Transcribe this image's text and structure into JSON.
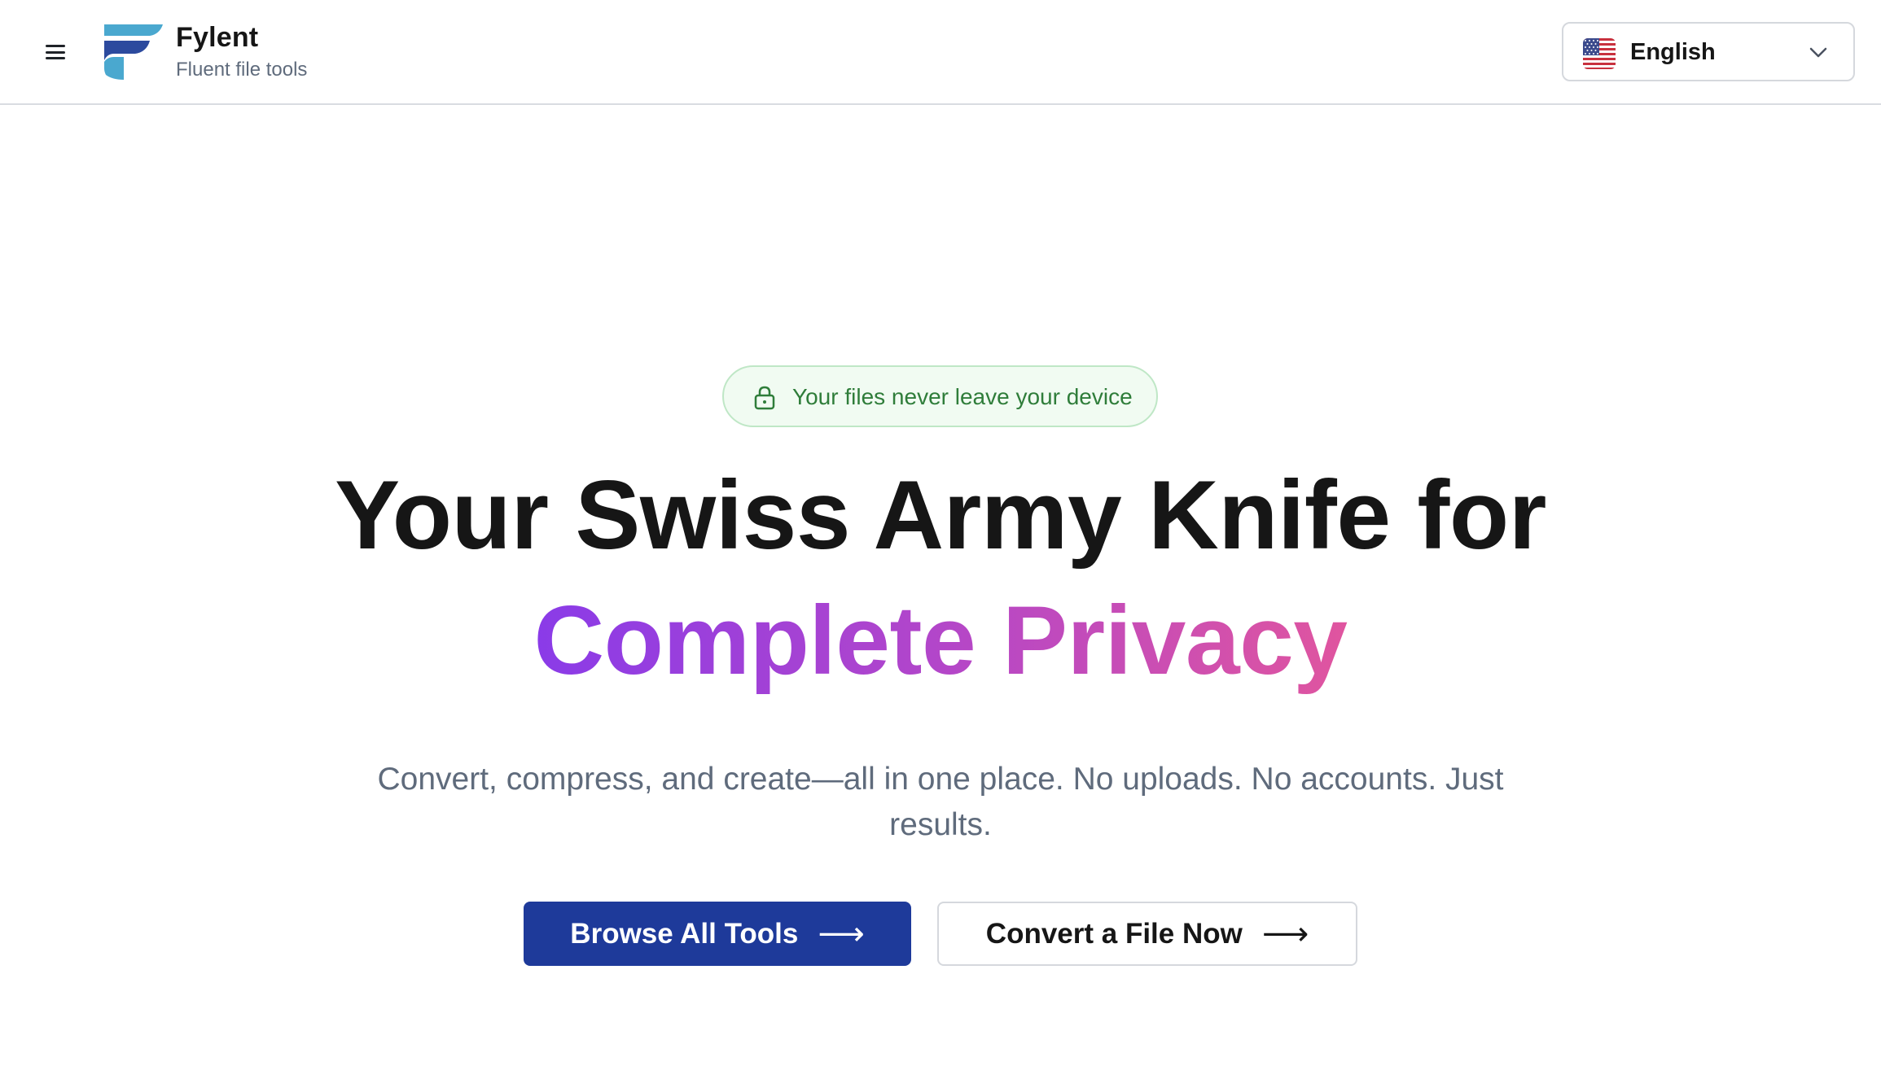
{
  "header": {
    "brand_name": "Fylent",
    "brand_tagline": "Fluent file tools",
    "language": {
      "selected": "English",
      "flag_icon": "us-flag-icon"
    }
  },
  "hero": {
    "badge_text": "Your files never leave your device",
    "headline_line1": "Your Swiss Army Knife for",
    "headline_line2": "Complete Privacy",
    "subtitle": "Convert, compress, and create—all in one place. No uploads. No accounts. Just results.",
    "primary_button": "Browse All Tools",
    "secondary_button": "Convert a File Now",
    "arrow_glyph": "⟶"
  },
  "colors": {
    "primary": "#1e3a9a",
    "gradient_start": "#8a3be8",
    "gradient_end": "#e0559f",
    "badge_text": "#2f7d3a",
    "badge_bg": "#f1fbf2",
    "muted_text": "#5f6b7c"
  }
}
